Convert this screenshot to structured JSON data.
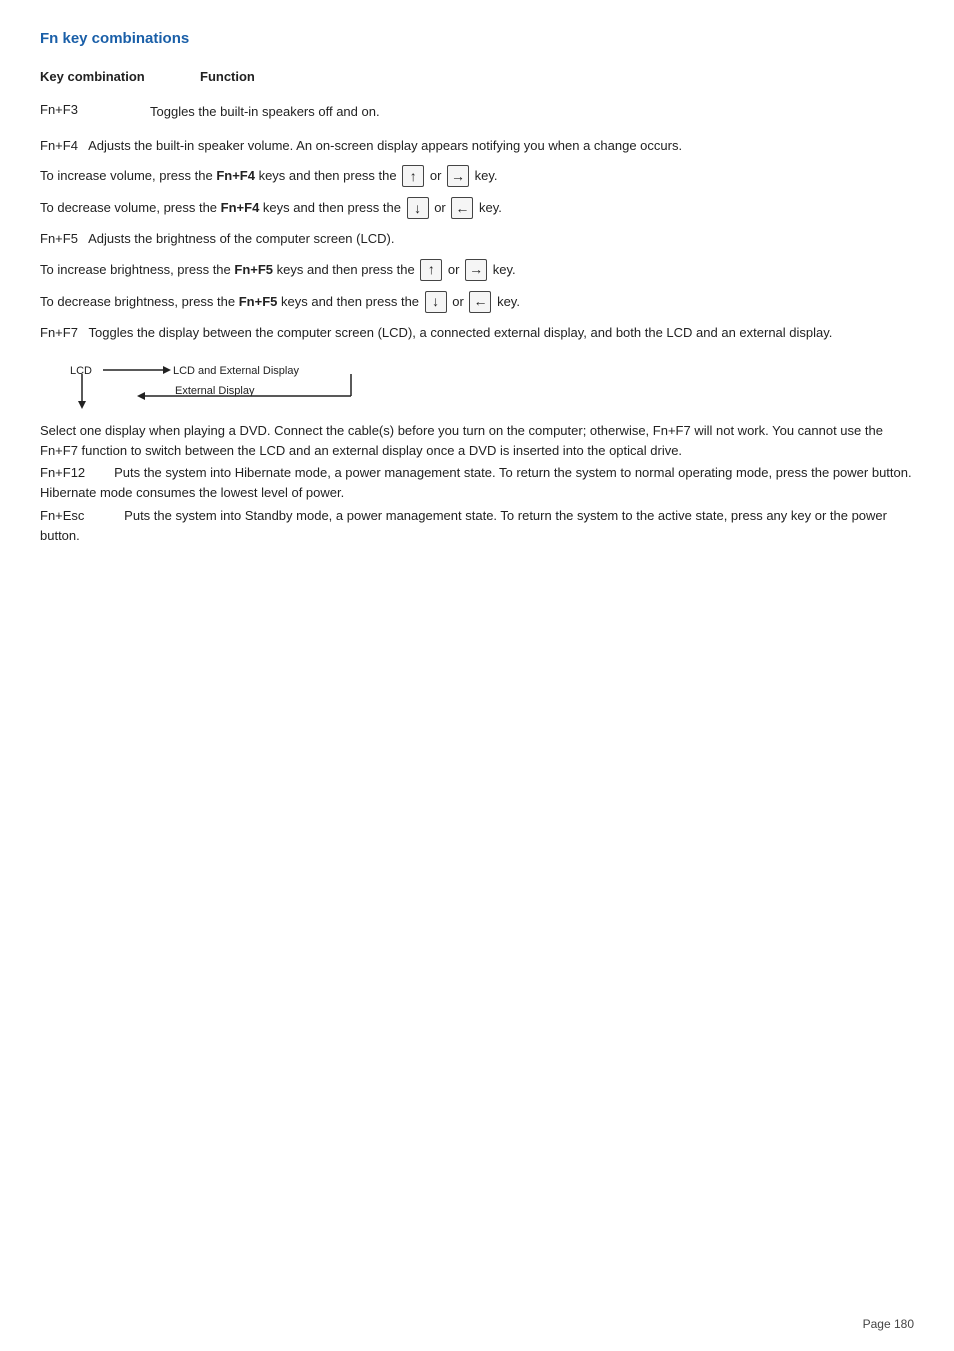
{
  "page": {
    "title": "Fn key combinations",
    "header": {
      "key_combination": "Key combination",
      "function": "Function"
    },
    "fn3": {
      "key": "Fn+F3",
      "description": "Toggles the built-in speakers off and on."
    },
    "fn4": {
      "key": "Fn+F4",
      "description": "Adjusts the built-in speaker volume. An on-screen display appears notifying you when a change occurs.",
      "increase": {
        "text_before": "To increase volume, press the ",
        "keys": "Fn+F4",
        "text_after": " keys and then press the ",
        "or": "or",
        "key_word": "key."
      },
      "decrease": {
        "text_before": "To decrease volume, press the ",
        "keys": "Fn+F4",
        "text_after": " keys and then press the ",
        "or": "or",
        "key_word": "key."
      }
    },
    "fn5": {
      "key": "Fn+F5",
      "description": "Adjusts the brightness of the computer screen (LCD).",
      "increase": {
        "text_before": "To increase brightness, press the ",
        "keys": "Fn+F5",
        "text_after": " keys and then press the ",
        "or": "or",
        "key_word": "key."
      },
      "decrease": {
        "text_before": "To decrease brightness, press the ",
        "keys": "Fn+F5",
        "text_after": " keys and then press the ",
        "or": "or",
        "key_word": "key."
      }
    },
    "fn7": {
      "key": "Fn+F7",
      "description": "Toggles the display between the computer screen (LCD), a connected external display, and both the LCD and an external display."
    },
    "notes": {
      "dvd_note": "Select one display when playing a DVD. Connect the cable(s) before you turn on the computer; otherwise, Fn+F7 will not work. You cannot use the Fn+F7 function to switch between the LCD and an external display once a DVD is inserted into the optical drive.",
      "fn_f12": "Fn+F12",
      "fn_f12_desc": "Puts the system into Hibernate mode, a power management state. To return the system to normal operating mode, press the power button. Hibernate mode consumes the lowest level of power.",
      "fn_esc": "Fn+Esc",
      "fn_esc_desc": "Puts the system into Standby mode, a power management state. To return the system to the active state, press any key or the power button."
    },
    "page_number": "Page 180"
  }
}
